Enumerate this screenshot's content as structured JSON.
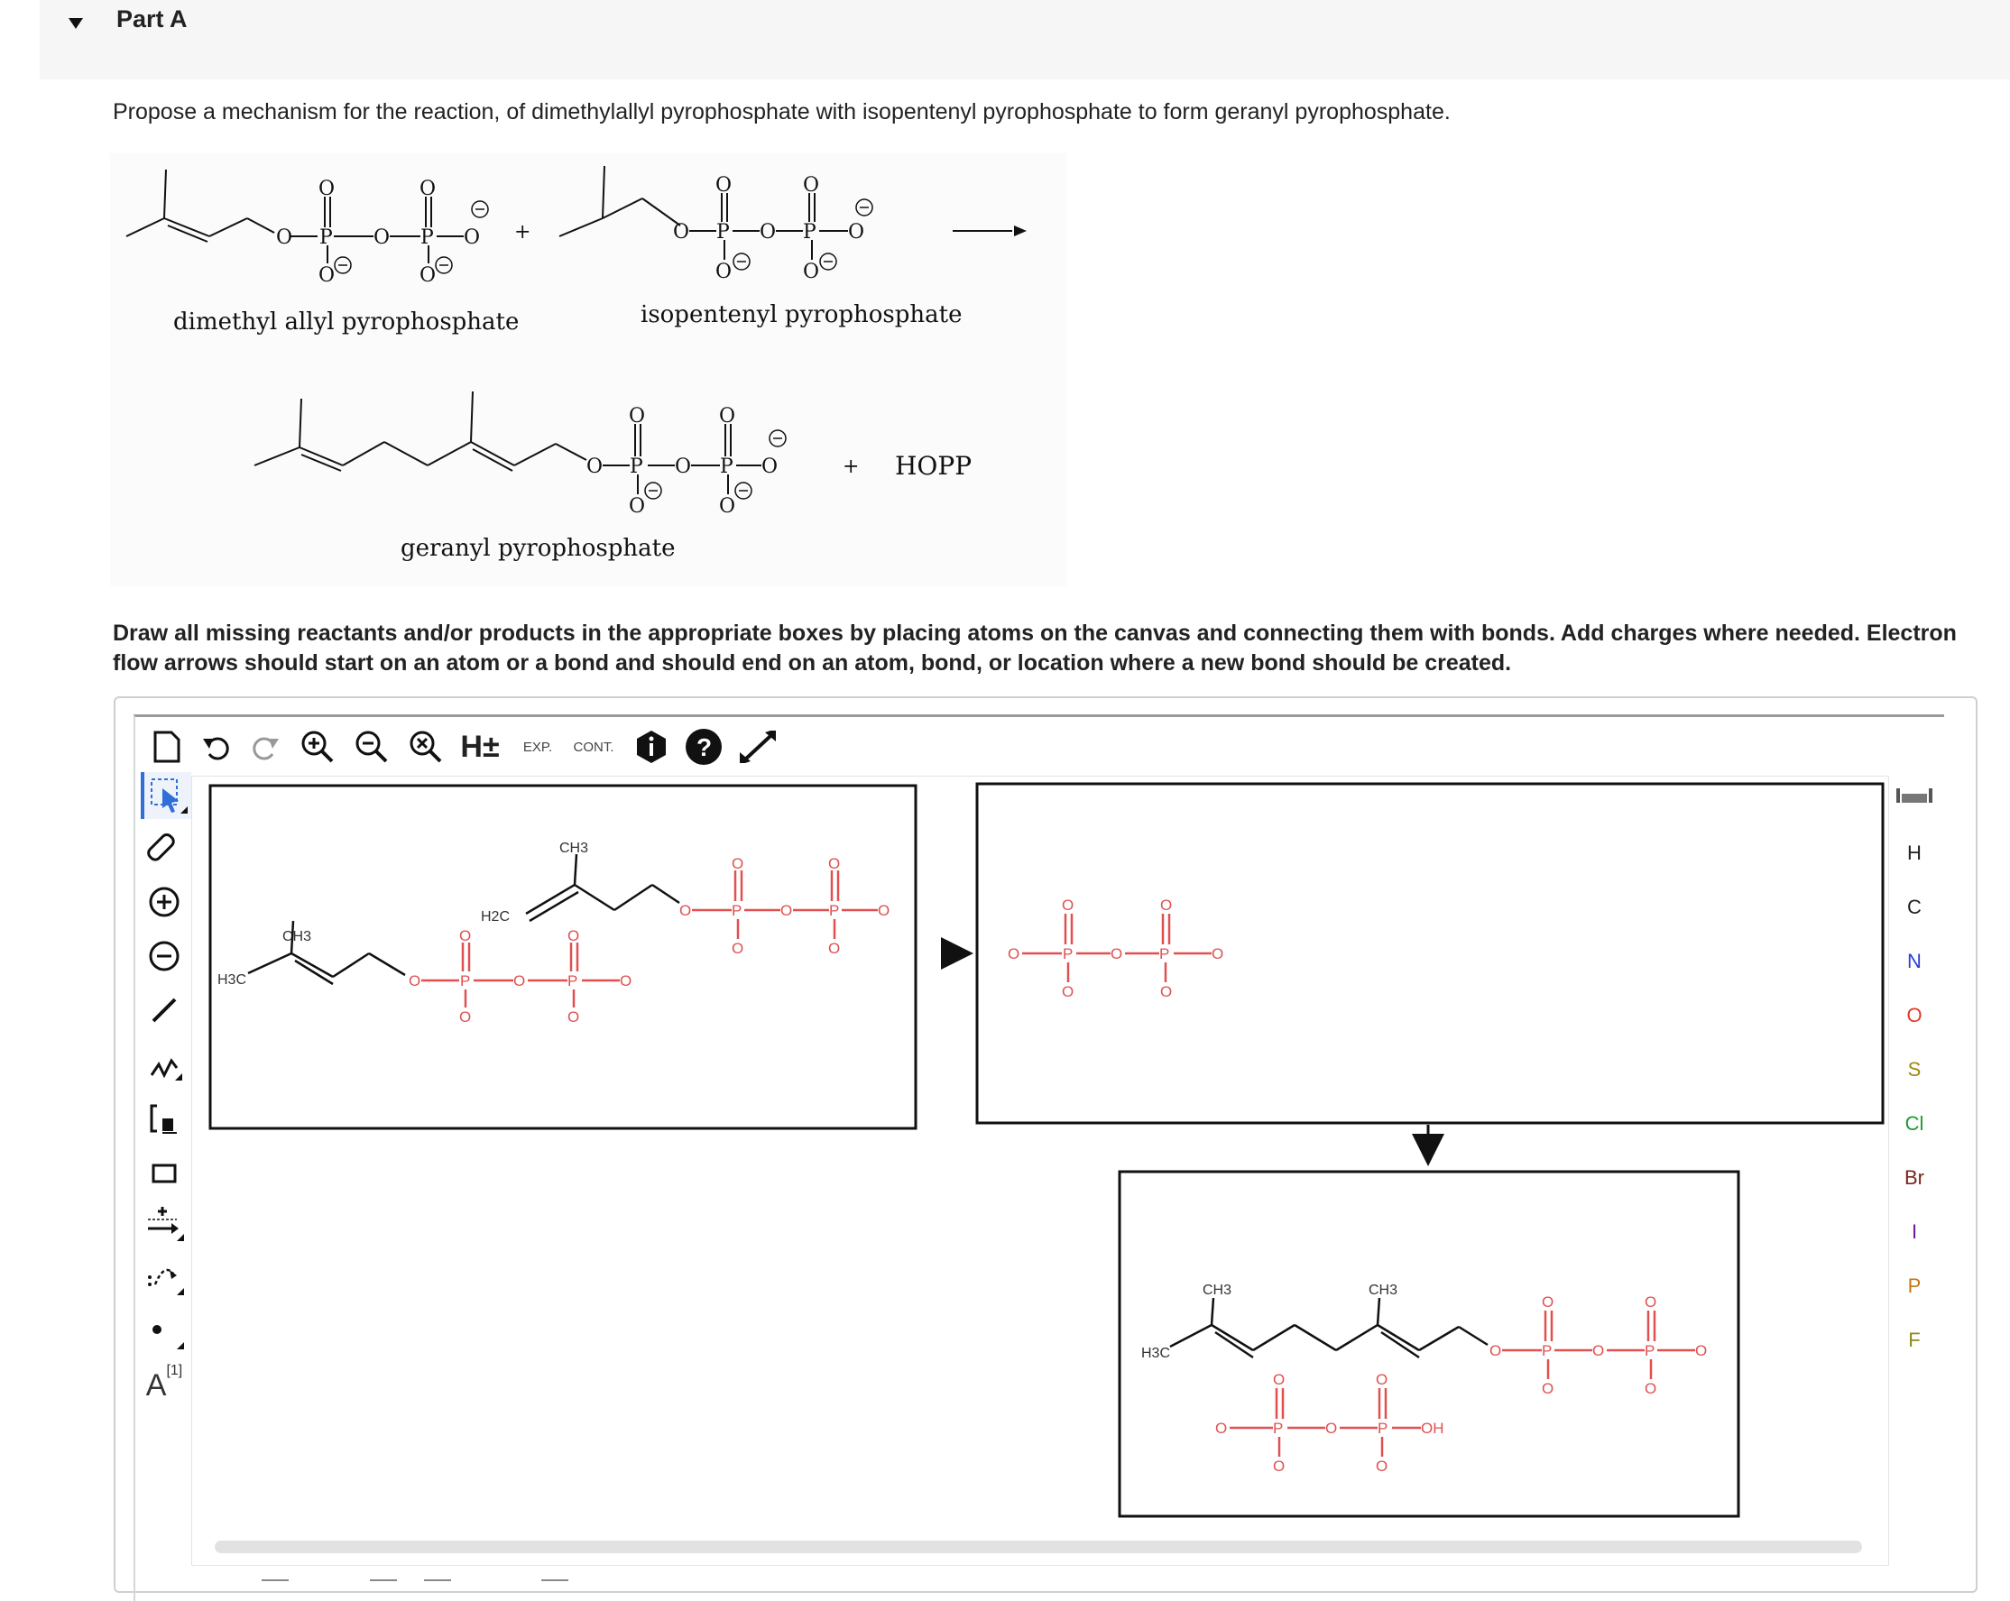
{
  "part": {
    "title": "Part A"
  },
  "question": {
    "prompt": "Propose a mechanism for the reaction, of dimethylallyl pyrophosphate with isopentenyl pyrophosphate to form geranyl pyrophosphate.",
    "instructions": "Draw all missing reactants and/or products in the appropriate boxes by placing atoms on the canvas and connecting them with bonds. Add charges where needed. Electron flow arrows should start on an atom or a bond and should end on an atom, bond, or location where a new bond should be created."
  },
  "scheme": {
    "reactant1_label": "dimethyl allyl pyrophosphate",
    "reactant2_label": "isopentenyl pyrophosphate",
    "product_label": "geranyl pyrophosphate",
    "byproduct": "HOPP",
    "plus": "+"
  },
  "toolbar": {
    "exp_label": "EXP.",
    "cont_label": "CONT.",
    "h_label": "H±"
  },
  "left_tools": {
    "atom_map_label": "A",
    "atom_map_index": "[1]"
  },
  "elements": [
    "H",
    "C",
    "N",
    "O",
    "S",
    "Cl",
    "Br",
    "I",
    "P",
    "F"
  ],
  "element_colors": {
    "H": "#333333",
    "C": "#222222",
    "N": "#2b3fd6",
    "O": "#e03a2c",
    "S": "#9a8a10",
    "Cl": "#1f9a2c",
    "Br": "#7a2418",
    "I": "#6a1b9a",
    "P": "#c77612",
    "F": "#8a8a1a"
  },
  "canvas": {
    "ch3": "CH3",
    "h2c": "H2C",
    "h3c": "H3C",
    "o": "O",
    "p": "P",
    "oh": "OH"
  }
}
